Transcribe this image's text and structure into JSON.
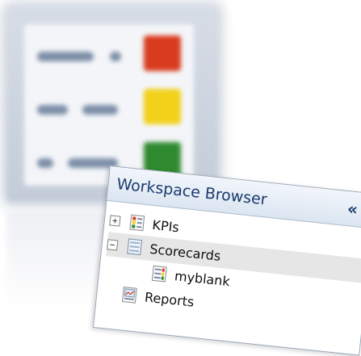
{
  "panel": {
    "title": "Workspace Browser",
    "collapse_glyph": "«"
  },
  "tree": {
    "items": [
      {
        "label": "KPIs",
        "expander": "+",
        "icon": "kpi-icon",
        "selected": false
      },
      {
        "label": "Scorecards",
        "expander": "−",
        "icon": "scorecard-icon",
        "selected": true
      },
      {
        "label": "myblank",
        "icon": "scorecard-item-icon",
        "selected": false
      },
      {
        "label": "Reports",
        "icon": "report-icon",
        "selected": false
      }
    ]
  },
  "colors": {
    "header_text": "#1b3b6f",
    "status_red": "#d93b1f",
    "status_yellow": "#f2d11a",
    "status_green": "#2f8a2f",
    "selected_row": "#e6e6e6"
  }
}
